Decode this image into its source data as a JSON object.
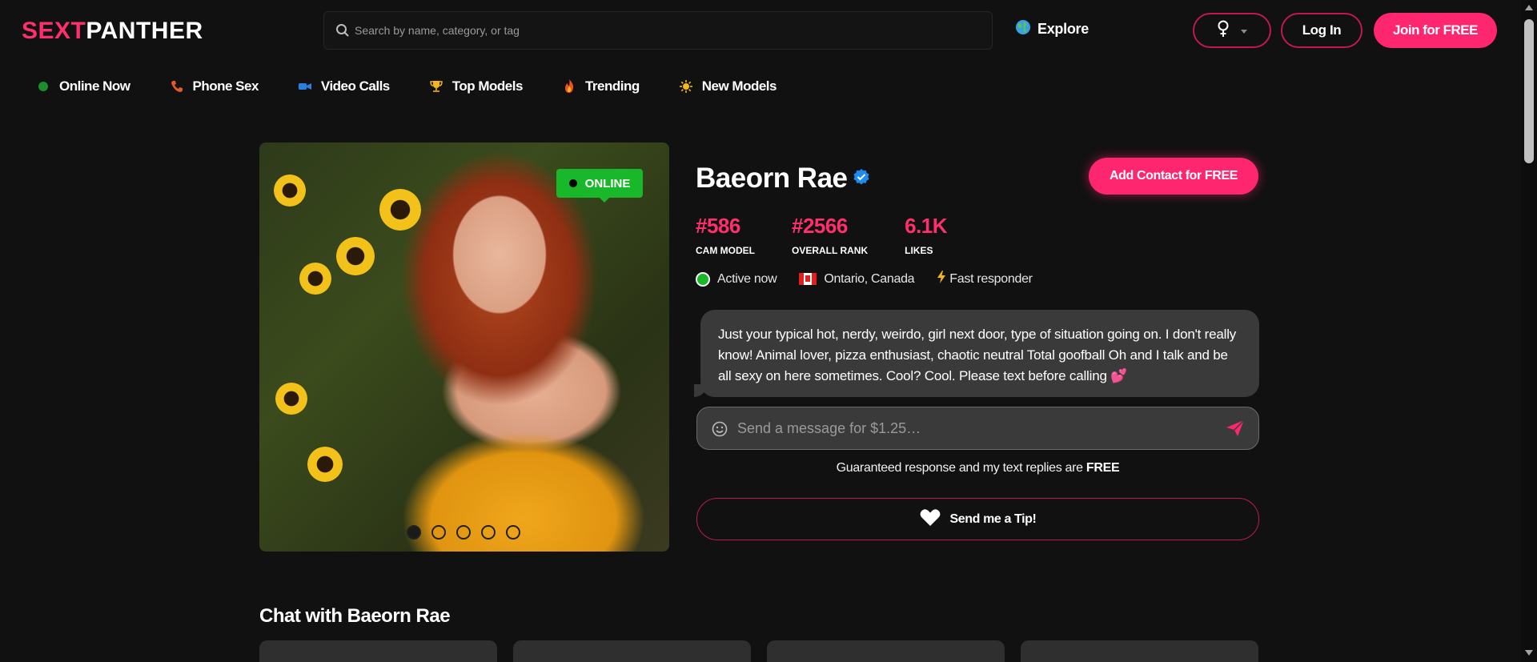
{
  "header": {
    "logo_part1": "SEXT",
    "logo_part2": "PANTHER",
    "search_placeholder": "Search by name, category, or tag",
    "explore_label": "Explore",
    "login_label": "Log In",
    "join_label": "Join for FREE"
  },
  "nav": {
    "items": [
      {
        "label": "Online Now",
        "icon": "green-dot-icon"
      },
      {
        "label": "Phone Sex",
        "icon": "phone-icon"
      },
      {
        "label": "Video Calls",
        "icon": "video-camera-icon"
      },
      {
        "label": "Top Models",
        "icon": "trophy-icon"
      },
      {
        "label": "Trending",
        "icon": "fire-icon"
      },
      {
        "label": "New Models",
        "icon": "sun-icon"
      }
    ]
  },
  "profile": {
    "online_badge": "ONLINE",
    "name": "Baeorn Rae",
    "add_contact_label": "Add Contact for FREE",
    "stats": [
      {
        "value": "#586",
        "label": "CAM MODEL"
      },
      {
        "value": "#2566",
        "label": "OVERALL RANK"
      },
      {
        "value": "6.1K",
        "label": "LIKES"
      }
    ],
    "status": "Active now",
    "location": "Ontario, Canada",
    "fast_responder": "Fast responder",
    "bio": "Just your typical hot, nerdy, weirdo, girl next door, type of situation going on. I don't really know! Animal lover, pizza enthusiast, chaotic neutral Total goofball Oh and I talk and be all sexy on here sometimes. Cool? Cool. Please text before calling 💕",
    "message_placeholder": "Send a message for $1.25…",
    "guarantee_text": "Guaranteed response and my text replies are ",
    "guarantee_bold": "FREE",
    "tip_label": "Send me a Tip!",
    "photo_count": 5,
    "active_photo": 1
  },
  "chat_section": {
    "title": "Chat with Baeorn Rae"
  },
  "colors": {
    "accent": "#ff2670",
    "online": "#19b82a",
    "background": "#111111"
  }
}
